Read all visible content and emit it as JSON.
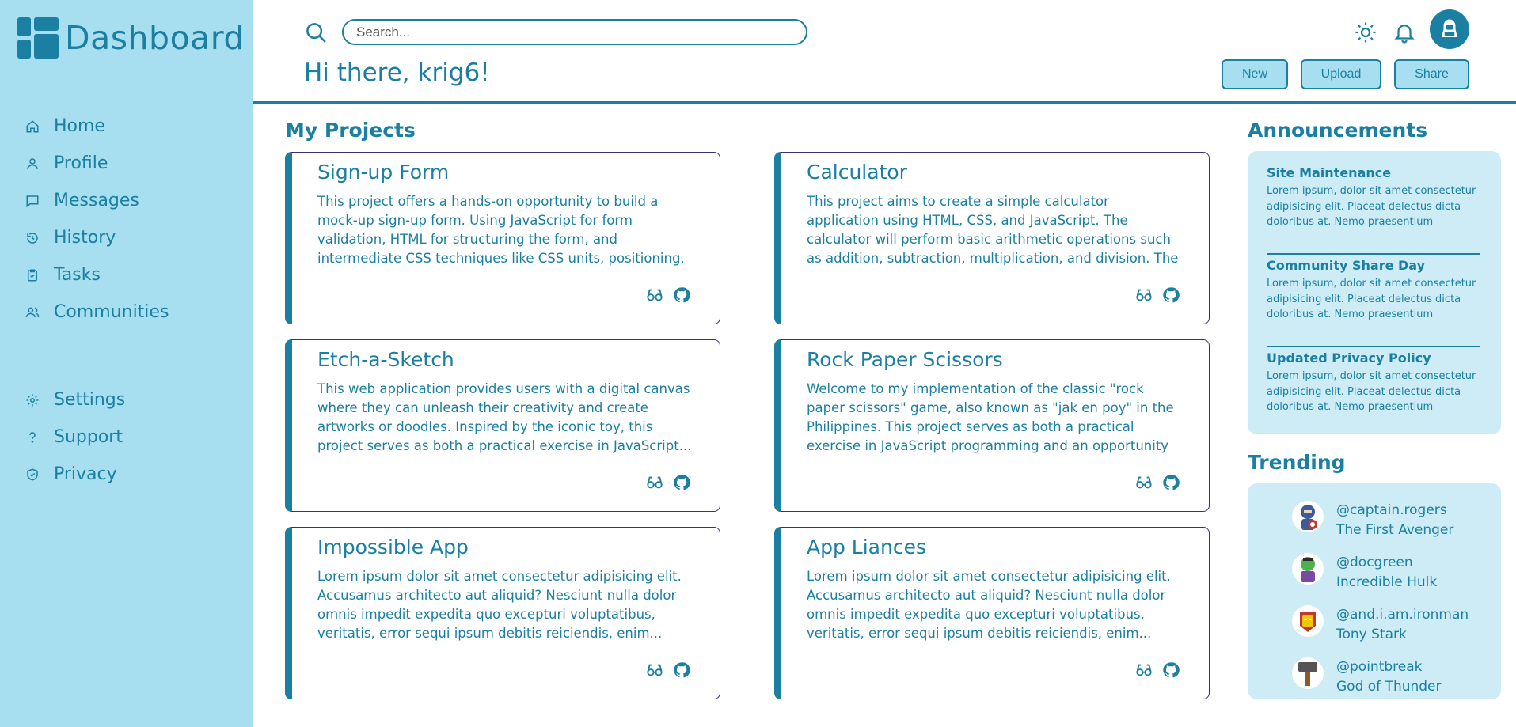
{
  "sidebar": {
    "title": "Dashboard",
    "nav_top": [
      {
        "label": "Home",
        "icon": "home-icon"
      },
      {
        "label": "Profile",
        "icon": "user-icon"
      },
      {
        "label": "Messages",
        "icon": "message-icon"
      },
      {
        "label": "History",
        "icon": "history-icon"
      },
      {
        "label": "Tasks",
        "icon": "clipboard-check-icon"
      },
      {
        "label": "Communities",
        "icon": "users-icon"
      }
    ],
    "nav_bottom": [
      {
        "label": "Settings",
        "icon": "gear-icon"
      },
      {
        "label": "Support",
        "icon": "question-icon"
      },
      {
        "label": "Privacy",
        "icon": "shield-icon"
      }
    ]
  },
  "header": {
    "search_placeholder": "Search...",
    "greeting": "Hi there, krig6!",
    "buttons": {
      "new": "New",
      "upload": "Upload",
      "share": "Share"
    }
  },
  "projects": {
    "title": "My Projects",
    "items": [
      {
        "title": "Sign-up Form",
        "description": "This project offers a hands-on opportunity to build a mock-up sign-up form. Using JavaScript for form validation, HTML for structuring the form, and intermediate CSS techniques like CSS units, positioning, and advanced selectors, you'll..."
      },
      {
        "title": "Calculator",
        "description": "This project aims to create a simple calculator application using HTML, CSS, and JavaScript. The calculator will perform basic arithmetic operations such as addition, subtraction, multiplication, and division. The goal is to..."
      },
      {
        "title": "Etch-a-Sketch",
        "description": "This web application provides users with a digital canvas where they can unleash their creativity and create artworks or doodles. Inspired by the iconic toy, this project serves as both a practical exercise in JavaScript..."
      },
      {
        "title": "Rock Paper Scissors",
        "description": "Welcome to my implementation of the classic \"rock paper scissors\" game, also known as \"jak en poy\" in the Philippines. This project serves as both a practical exercise in JavaScript programming and an opportunity to explore..."
      },
      {
        "title": "Impossible App",
        "description": "Lorem ipsum dolor sit amet consectetur adipisicing elit. Accusamus architecto aut aliquid? Nesciunt nulla dolor omnis impedit expedita quo excepturi voluptatibus, veritatis, error sequi ipsum debitis reiciendis, enim..."
      },
      {
        "title": "App Liances",
        "description": "Lorem ipsum dolor sit amet consectetur adipisicing elit. Accusamus architecto aut aliquid? Nesciunt nulla dolor omnis impedit expedita quo excepturi voluptatibus, veritatis, error sequi ipsum debitis reiciendis, enim..."
      }
    ]
  },
  "announcements": {
    "title": "Announcements",
    "items": [
      {
        "title": "Site Maintenance",
        "body": "Lorem ipsum, dolor sit amet consectetur adipisicing elit. Placeat delectus dicta doloribus at. Nemo praesentium quaerat..."
      },
      {
        "title": "Community Share Day",
        "body": "Lorem ipsum, dolor sit amet consectetur adipisicing elit. Placeat delectus dicta doloribus at. Nemo praesentium quaerat..."
      },
      {
        "title": "Updated Privacy Policy",
        "body": "Lorem ipsum, dolor sit amet consectetur adipisicing elit. Placeat delectus dicta doloribus at. Nemo praesentium quaerat..."
      }
    ]
  },
  "trending": {
    "title": "Trending",
    "items": [
      {
        "handle": "@captain.rogers",
        "name": "The First Avenger",
        "avatar_color": "#3a5a9a"
      },
      {
        "handle": "@docgreen",
        "name": "Incredible Hulk",
        "avatar_color": "#4caf50"
      },
      {
        "handle": "@and.i.am.ironman",
        "name": "Tony Stark",
        "avatar_color": "#c0392b"
      },
      {
        "handle": "@pointbreak",
        "name": "God of Thunder",
        "avatar_color": "#555555"
      }
    ]
  },
  "colors": {
    "accent": "#1a7fa0",
    "sidebar": "#a7def0",
    "panel": "#cdecf6",
    "card_border": "#3b2d7a"
  }
}
